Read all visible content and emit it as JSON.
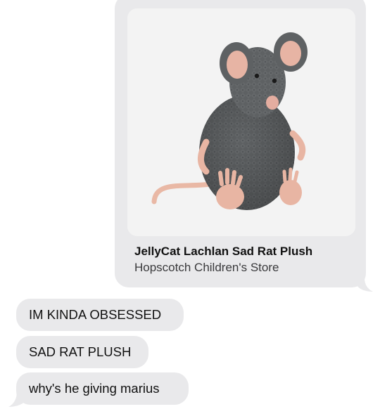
{
  "link_preview": {
    "title": "JellyCat Lachlan Sad Rat Plush",
    "source": "Hopscotch Children's Store",
    "image": "grey-rat-plush-toy-photo"
  },
  "messages": [
    {
      "text": "IM KINDA OBSESSED",
      "direction": "incoming"
    },
    {
      "text": "SAD RAT PLUSH",
      "direction": "incoming"
    },
    {
      "text": "why's he giving marius",
      "direction": "incoming"
    }
  ],
  "colors": {
    "bubble": "#e9e9eb",
    "background": "#ffffff",
    "text": "#111111",
    "secondary_text": "#3a3a3c"
  }
}
